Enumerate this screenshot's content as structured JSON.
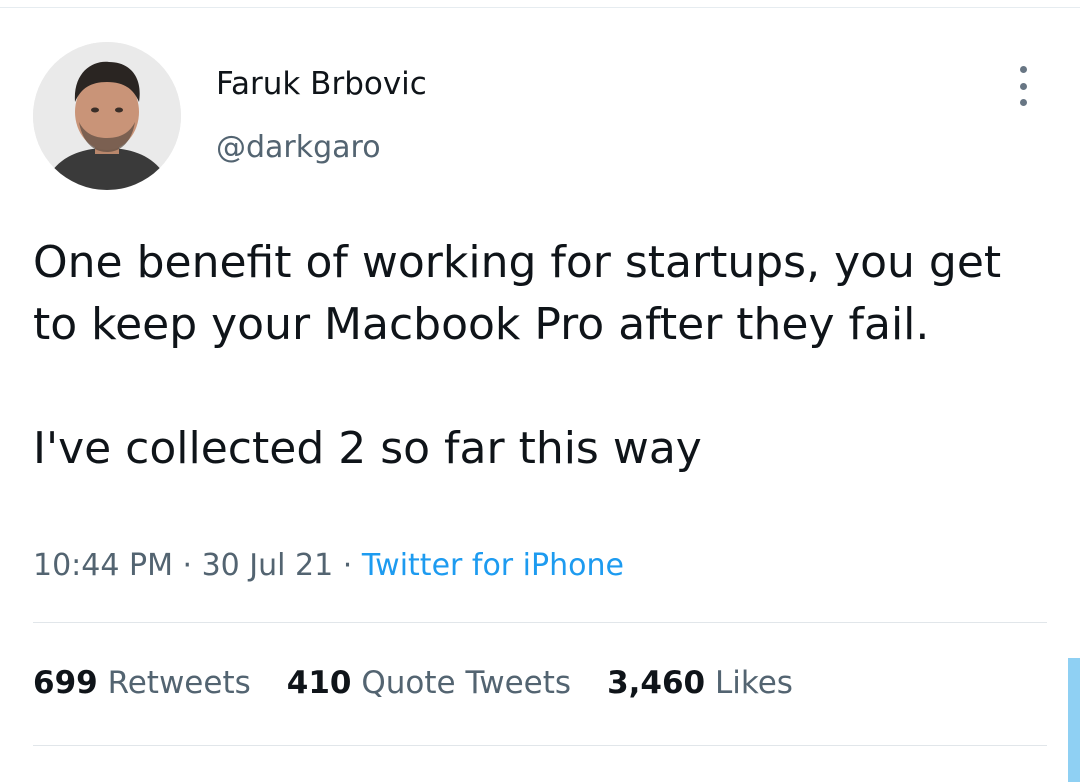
{
  "tweet": {
    "author": {
      "display_name": "Faruk Brbovic",
      "handle": "@darkgaro"
    },
    "text_paragraphs": [
      "One benefit of working for startups, you get to keep your Macbook Pro after they fail.",
      "I've collected 2 so far this way"
    ],
    "time": "10:44 PM",
    "date": "30 Jul 21",
    "separator": " · ",
    "source": "Twitter for iPhone",
    "stats": {
      "retweets_count": "699",
      "retweets_label": "Retweets",
      "quotes_count": "410",
      "quotes_label": "Quote Tweets",
      "likes_count": "3,460",
      "likes_label": "Likes"
    }
  },
  "icons": {
    "more": "more-vertical-icon"
  },
  "colors": {
    "text_primary": "#0f1419",
    "text_secondary": "#536471",
    "link": "#1d9bf0",
    "divider": "#e1e6ea"
  }
}
